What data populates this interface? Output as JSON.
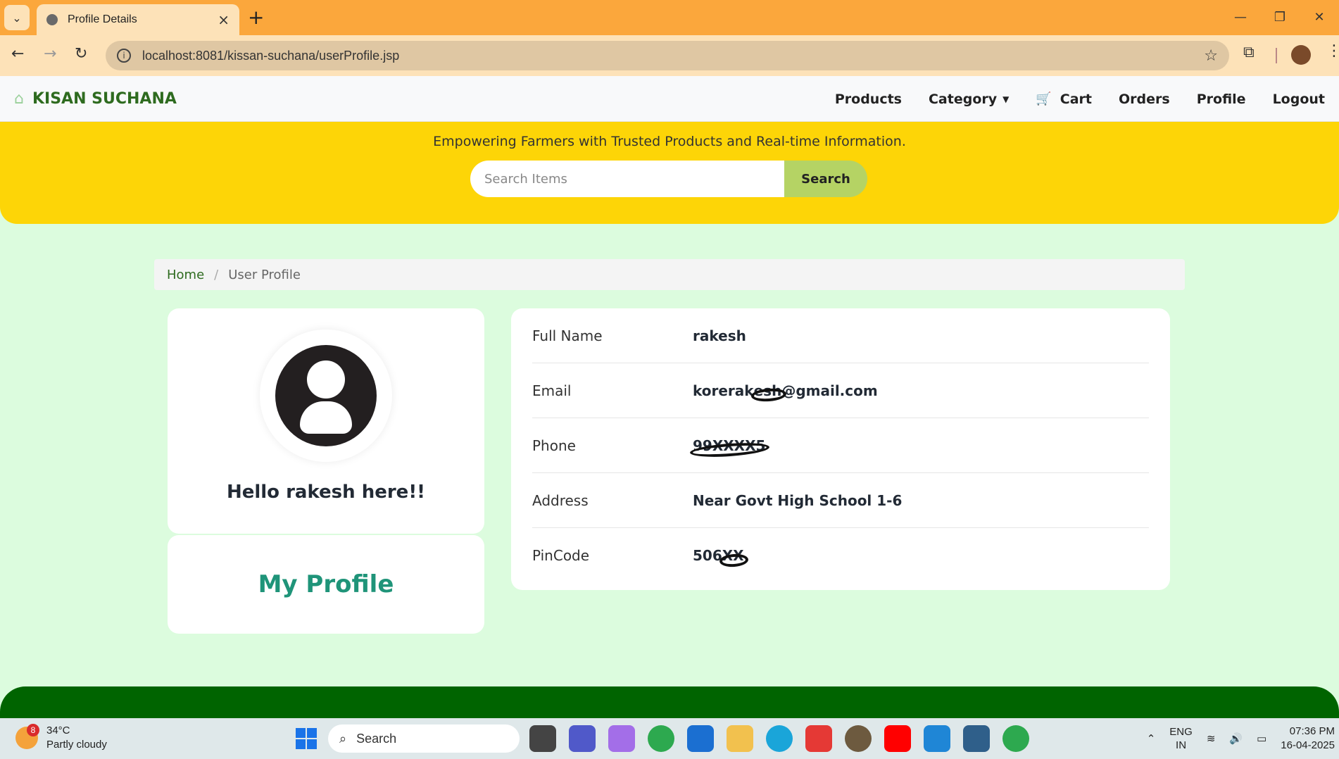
{
  "browser": {
    "tab_title": "Profile Details",
    "url": "localhost:8081/kissan-suchana/userProfile.jsp"
  },
  "navbar": {
    "brand": "KISAN SUCHANA",
    "links": {
      "products": "Products",
      "category": "Category",
      "cart": "Cart",
      "orders": "Orders",
      "profile": "Profile",
      "logout": "Logout"
    }
  },
  "hero": {
    "tagline": "Empowering Farmers with Trusted Products and Real-time Information.",
    "search_placeholder": "Search Items",
    "search_button": "Search"
  },
  "breadcrumb": {
    "home": "Home",
    "current": "User Profile"
  },
  "profile": {
    "greeting": "Hello rakesh here!!",
    "section_title": "My Profile"
  },
  "details": {
    "full_name_label": "Full Name",
    "full_name": "rakesh",
    "email_label": "Email",
    "email_prefix": "korerak",
    "email_redacted": "esh",
    "email_suffix": "@gmail.com",
    "phone_label": "Phone",
    "phone_redacted": "99XXXX5",
    "address_label": "Address",
    "address": "Near Govt High School 1-6",
    "pincode_label": "PinCode",
    "pincode_prefix": "506",
    "pincode_redacted": "XX"
  },
  "taskbar": {
    "weather_badge": "8",
    "temperature": "34°C",
    "weather": "Partly cloudy",
    "search": "Search",
    "lang": "ENG",
    "region": "IN",
    "time": "07:36 PM",
    "date": "16-04-2025"
  },
  "colors": {
    "hero_bg": "#fdd507",
    "brand_green": "#2e6b1f",
    "page_bg": "#dcfcde",
    "footer_bg": "#006400",
    "accent_teal": "#1f9479"
  }
}
